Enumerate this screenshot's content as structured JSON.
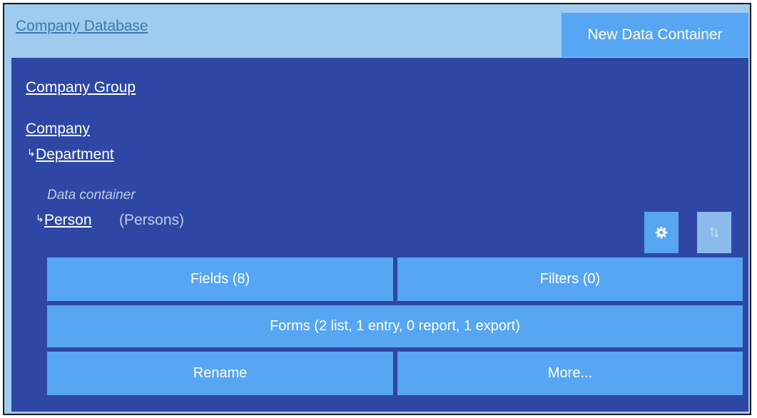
{
  "header": {
    "database_link": "Company Database",
    "new_container_label": "New Data Container"
  },
  "hierarchy": {
    "group_link": "Company Group",
    "company_link": "Company",
    "department_link": "Department",
    "arrow_glyph": "↳",
    "data_container_label": "Data container",
    "person_link": "Person",
    "person_suffix": "(Persons)"
  },
  "icons": {
    "settings": "gear-icon",
    "sort": "sort-icon"
  },
  "actions": {
    "fields_label": "Fields (8)",
    "filters_label": "Filters (0)",
    "forms_label": "Forms (2 list, 1 entry, 0 report, 1 export)",
    "rename_label": "Rename",
    "more_label": "More..."
  },
  "colors": {
    "outer_background": "#9fcbef",
    "panel_background": "#2e47a4",
    "button_background": "#56a6f3",
    "disabled_button": "#8bbbec"
  }
}
